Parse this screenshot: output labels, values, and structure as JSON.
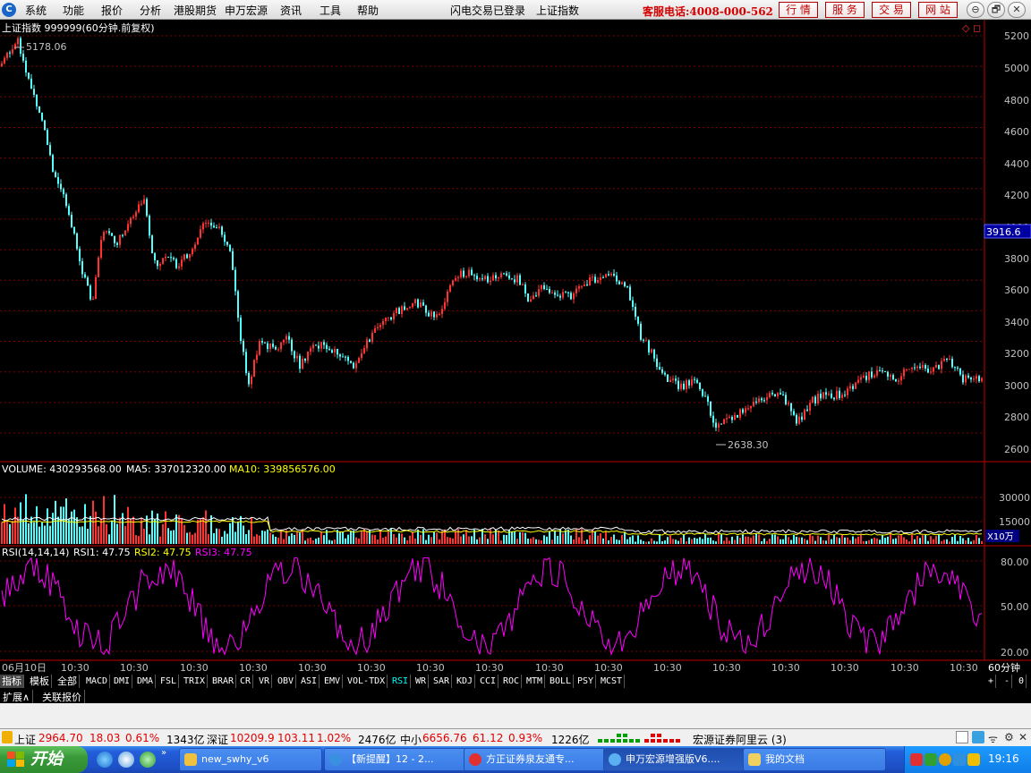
{
  "menubar": {
    "logo": "C",
    "items": [
      "系统",
      "功能",
      "报价",
      "分析",
      "港股期货",
      "申万宏源",
      "资讯",
      "工具",
      "帮助"
    ],
    "status_login": "闪电交易已登录",
    "current_index": "上证指数",
    "hotline": "客服电话:4008-000-562",
    "buttons": [
      "行 情",
      "服 务",
      "交 易",
      "网 站"
    ],
    "window_controls": [
      "⊖",
      "🗗",
      "✕"
    ]
  },
  "main_chart": {
    "header": "上证指数 999999(60分钟.前复权)",
    "high_label": "5178.06",
    "low_label": "2638.30",
    "current_price_tag": "3916.6",
    "y_ticks": [
      "5200",
      "5000",
      "4800",
      "4600",
      "4400",
      "4200",
      "4000",
      "3800",
      "3600",
      "3400",
      "3200",
      "3000",
      "2800",
      "2600"
    ],
    "corner_icons": [
      "◇",
      "◻"
    ]
  },
  "volume_panel": {
    "label_volume": "VOLUME: 430293568.00",
    "label_ma5": "MA5: 337012320.00",
    "label_ma10": "MA10: 339856576.00",
    "y_ticks": [
      "30000",
      "15000"
    ],
    "unit": "X10万"
  },
  "rsi_panel": {
    "label_main": "RSI(14,14,14)",
    "label_rsi1": "RSI1: 47.75",
    "label_rsi2": "RSI2: 47.75",
    "label_rsi3": "RSI3: 47.75",
    "y_ticks": [
      "80.00",
      "50.00",
      "20.00"
    ]
  },
  "time_axis": {
    "first": "06月10日",
    "labels": [
      "10:30",
      "10:30",
      "10:30",
      "10:30",
      "10:30",
      "10:30",
      "10:30",
      "10:30",
      "10:30",
      "10:30",
      "10:30",
      "10:30",
      "10:30",
      "10:30",
      "10:30",
      "10:30"
    ],
    "period": "60分钟"
  },
  "indicator_tabs": [
    "指标",
    "模板",
    "全部",
    "MACD",
    "DMI",
    "DMA",
    "FSL",
    "TRIX",
    "BRAR",
    "CR",
    "VR",
    "OBV",
    "ASI",
    "EMV",
    "VOL-TDX",
    "RSI",
    "WR",
    "SAR",
    "KDJ",
    "CCI",
    "ROC",
    "MTM",
    "BOLL",
    "PSY",
    "MCST"
  ],
  "zoom_buttons": [
    "+",
    "-",
    "0"
  ],
  "ext_tabs": [
    "扩展∧",
    "关联报价"
  ],
  "status": {
    "sh_name": "上证",
    "sh_value": "2964.70",
    "sh_change": "18.03",
    "sh_pct": "0.61%",
    "sh_amount": "1343亿",
    "sz_name": "深证",
    "sz_value": "10209.9",
    "sz_change": "103.11",
    "sz_pct": "1.02%",
    "sz_amount": "2476亿",
    "zx_name": "中小",
    "zx_value": "6656.76",
    "zx_change": "61.12",
    "zx_pct": "0.93%",
    "zx_amount": "1226亿",
    "broker": "宏源证券阿里云 (3)"
  },
  "taskbar": {
    "start": "开始",
    "tasks": [
      "new_swhy_v6",
      "【新提醒】12 - 2...",
      "方正证券泉友通专...",
      "申万宏源增强版V6....",
      "我的文档"
    ],
    "clock": "19:16"
  },
  "colors": {
    "up": "#ff3232",
    "down": "#54ffff",
    "ma5": "#ffffff",
    "ma10": "#ffff00",
    "rsi": "#ff00ff",
    "grid": "#800000",
    "axis_text": "#c0c0c0"
  }
}
